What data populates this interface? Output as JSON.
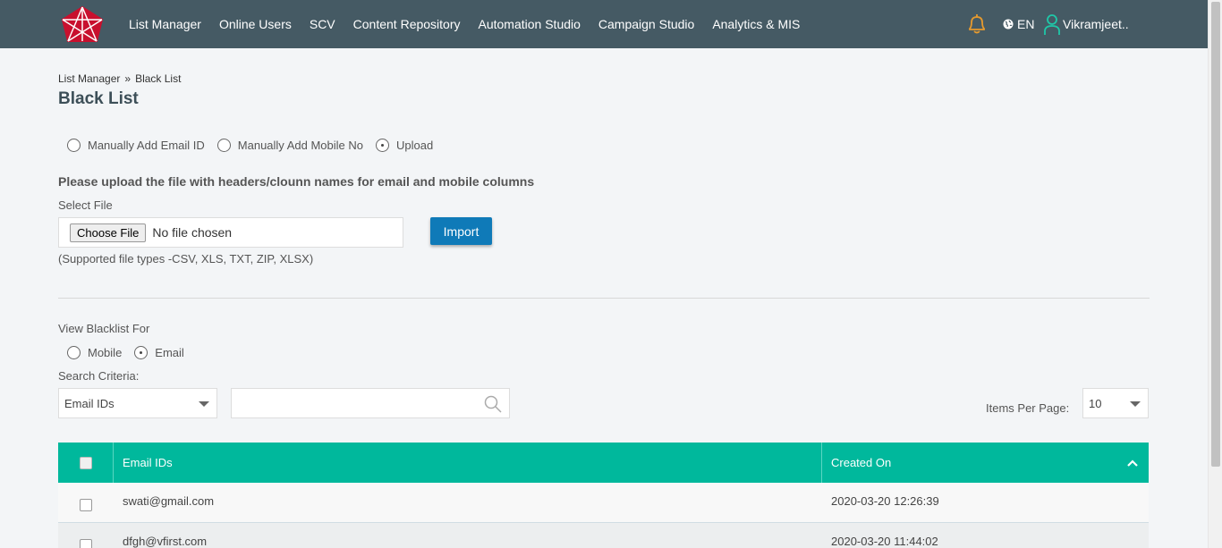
{
  "nav": {
    "items": [
      "List Manager",
      "Online Users",
      "SCV",
      "Content Repository",
      "Automation Studio",
      "Campaign Studio",
      "Analytics & MIS"
    ],
    "lang": "EN",
    "user": "Vikramjeet.."
  },
  "breadcrumb": {
    "parent": "List Manager",
    "separator": "»",
    "current": "Black List"
  },
  "page_title": "Black List",
  "add_mode": {
    "options": [
      "Manually Add Email ID",
      "Manually Add Mobile No",
      "Upload"
    ],
    "selected": "Upload"
  },
  "upload": {
    "note": "Please upload the file with headers/clounn names for email and mobile columns",
    "select_label": "Select File",
    "choose_button": "Choose File",
    "file_status": "No file chosen",
    "import_button": "Import",
    "supported": "(Supported file types -CSV, XLS, TXT, ZIP, XLSX)"
  },
  "view": {
    "label": "View Blacklist For",
    "options": [
      "Mobile",
      "Email"
    ],
    "selected": "Email"
  },
  "search": {
    "label": "Search Criteria:",
    "criteria": "Email IDs",
    "query": ""
  },
  "pagination": {
    "label": "Items Per Page:",
    "value": "10"
  },
  "table": {
    "columns": [
      "Email IDs",
      "Created On"
    ],
    "rows": [
      {
        "email": "swati@gmail.com",
        "created": "2020-03-20 12:26:39"
      },
      {
        "email": "dfgh@vfirst.com",
        "created": "2020-03-20 11:44:02"
      }
    ]
  },
  "colors": {
    "navbar": "#455a64",
    "accent": "#00b89c",
    "button": "#0f7ab8",
    "bell": "#e69a2e",
    "user_icon": "#1fc8a8"
  },
  "icons": {
    "logo": "star-logo",
    "bell": "bell-icon",
    "globe": "globe-icon",
    "user": "user-icon",
    "search": "search-icon",
    "sort": "chevron-up-icon"
  }
}
